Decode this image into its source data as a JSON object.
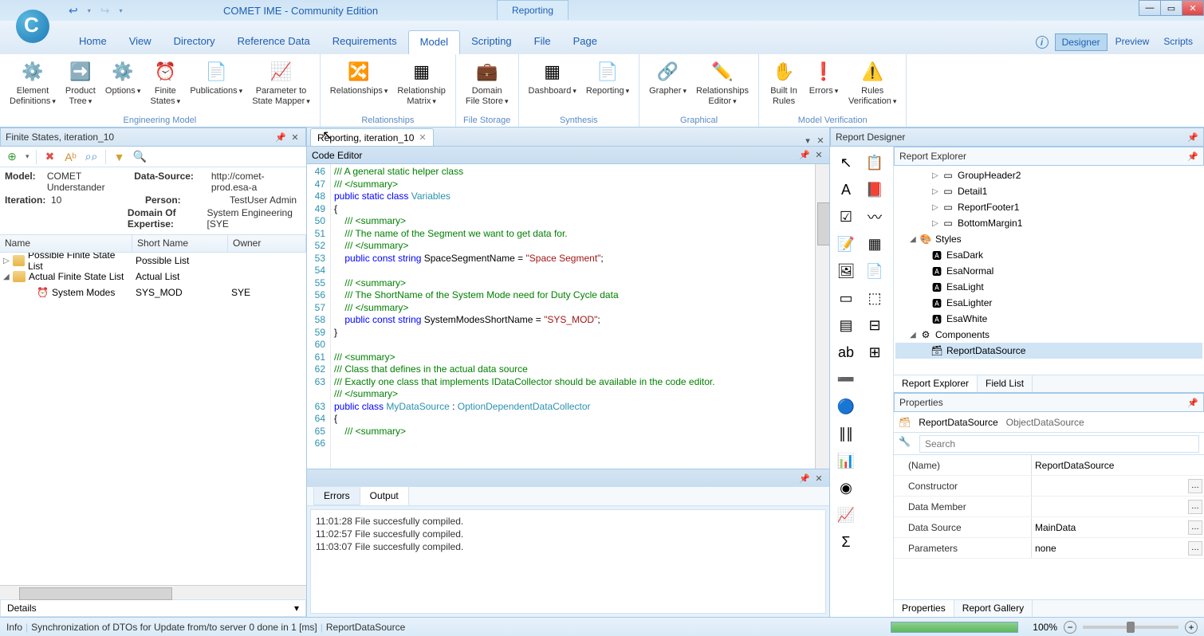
{
  "titlebar": {
    "app_title": "COMET IME - Community Edition",
    "context_tab": "Reporting"
  },
  "menu": {
    "items": [
      "Home",
      "View",
      "Directory",
      "Reference Data",
      "Requirements",
      "Model",
      "Scripting",
      "File",
      "Page"
    ],
    "active": "Model",
    "right": [
      "Designer",
      "Preview",
      "Scripts"
    ],
    "right_active": "Designer"
  },
  "ribbon": {
    "groups": [
      {
        "label": "Engineering Model",
        "buttons": [
          {
            "label": "Element\nDefinitions",
            "icon": "⚙️",
            "dd": true
          },
          {
            "label": "Product\nTree",
            "icon": "➡️",
            "dd": true
          },
          {
            "label": "Options",
            "icon": "⚙️",
            "dd": true
          },
          {
            "label": "Finite\nStates",
            "icon": "⏰",
            "dd": true
          },
          {
            "label": "Publications",
            "icon": "📄",
            "dd": true
          },
          {
            "label": "Parameter to\nState Mapper",
            "icon": "📈",
            "dd": true
          }
        ]
      },
      {
        "label": "Relationships",
        "buttons": [
          {
            "label": "Relationships",
            "icon": "🔀",
            "dd": true
          },
          {
            "label": "Relationship\nMatrix",
            "icon": "▦",
            "dd": true
          }
        ]
      },
      {
        "label": "File Storage",
        "buttons": [
          {
            "label": "Domain\nFile Store",
            "icon": "💼",
            "dd": true
          }
        ]
      },
      {
        "label": "Synthesis",
        "buttons": [
          {
            "label": "Dashboard",
            "icon": "▦",
            "dd": true
          },
          {
            "label": "Reporting",
            "icon": "📄",
            "dd": true
          }
        ]
      },
      {
        "label": "Graphical",
        "buttons": [
          {
            "label": "Grapher",
            "icon": "🔗",
            "dd": true
          },
          {
            "label": "Relationships\nEditor",
            "icon": "✏️",
            "dd": true
          }
        ]
      },
      {
        "label": "Model Verification",
        "buttons": [
          {
            "label": "Built In\nRules",
            "icon": "✋",
            "dd": false
          },
          {
            "label": "Errors",
            "icon": "❗",
            "dd": true
          },
          {
            "label": "Rules\nVerification",
            "icon": "⚠️",
            "dd": true
          }
        ]
      }
    ]
  },
  "left": {
    "title": "Finite States, iteration_10",
    "info": {
      "model_label": "Model:",
      "model": "COMET Understander",
      "ds_label": "Data-Source:",
      "ds": "http://comet-prod.esa-a",
      "iter_label": "Iteration:",
      "iter": "10",
      "person_label": "Person:",
      "person": "TestUser Admin",
      "doe_label": "Domain Of Expertise:",
      "doe": "System Engineering [SYE"
    },
    "cols": {
      "name": "Name",
      "short": "Short Name",
      "owner": "Owner"
    },
    "rows": [
      {
        "indent": 0,
        "exp": "▷",
        "icon": "folder",
        "name": "Possible Finite State List",
        "short": "Possible List",
        "owner": ""
      },
      {
        "indent": 0,
        "exp": "◢",
        "icon": "folder",
        "name": "Actual Finite State List",
        "short": "Actual List",
        "owner": ""
      },
      {
        "indent": 1,
        "exp": "",
        "icon": "clock",
        "name": "System Modes",
        "short": "SYS_MOD",
        "owner": "SYE"
      }
    ],
    "details": "Details"
  },
  "center": {
    "tab": "Reporting, iteration_10",
    "code_title": "Code Editor",
    "code": {
      "start": 46,
      "lines": [
        {
          "t": "/// A general static helper class",
          "c": "comment"
        },
        {
          "t": "/// </summary>",
          "c": "comment"
        },
        {
          "raw": "<span class='c-keyword'>public</span> <span class='c-keyword'>static</span> <span class='c-keyword'>class</span> <span class='c-class'>Variables</span>"
        },
        {
          "t": "{",
          "c": ""
        },
        {
          "t": "    /// <summary>",
          "c": "comment"
        },
        {
          "t": "    /// The name of the Segment we want to get data for.",
          "c": "comment"
        },
        {
          "t": "    /// </summary>",
          "c": "comment"
        },
        {
          "raw": "    <span class='c-keyword'>public</span> <span class='c-keyword'>const</span> <span class='c-keyword'>string</span> SpaceSegmentName = <span class='c-string'>\"Space Segment\"</span>;"
        },
        {
          "t": "",
          "c": ""
        },
        {
          "t": "    /// <summary>",
          "c": "comment"
        },
        {
          "t": "    /// The ShortName of the System Mode need for Duty Cycle data",
          "c": "comment"
        },
        {
          "t": "    /// </summary>",
          "c": "comment"
        },
        {
          "raw": "    <span class='c-keyword'>public</span> <span class='c-keyword'>const</span> <span class='c-keyword'>string</span> SystemModesShortName = <span class='c-string'>\"SYS_MOD\"</span>;"
        },
        {
          "t": "}",
          "c": ""
        },
        {
          "t": "",
          "c": ""
        },
        {
          "t": "/// <summary>",
          "c": "comment"
        },
        {
          "t": "/// Class that defines in the actual data source",
          "c": "comment"
        },
        {
          "t": "/// Exactly one class that implements IDataCollector should be available in the code editor.",
          "c": "comment",
          "wrap": true
        },
        {
          "t": "/// </summary>",
          "c": "comment"
        },
        {
          "raw": "<span class='c-keyword'>public</span> <span class='c-keyword'>class</span> <span class='c-class'>MyDataSource</span> : <span class='c-class'>OptionDependentDataCollector</span>"
        },
        {
          "t": "{",
          "c": ""
        },
        {
          "t": "    /// <summary>",
          "c": "comment"
        }
      ]
    },
    "output": {
      "tabs": [
        "Errors",
        "Output"
      ],
      "active": "Output",
      "lines": [
        "11:01:28 File succesfully compiled.",
        "11:02:57 File succesfully compiled.",
        "11:03:07 File succesfully compiled."
      ]
    }
  },
  "right": {
    "designer_title": "Report Designer",
    "explorer_title": "Report Explorer",
    "explorer": [
      {
        "indent": 3,
        "exp": "▷",
        "icon": "▭",
        "label": "GroupHeader2"
      },
      {
        "indent": 3,
        "exp": "▷",
        "icon": "▭",
        "label": "Detail1"
      },
      {
        "indent": 3,
        "exp": "▷",
        "icon": "▭",
        "label": "ReportFooter1"
      },
      {
        "indent": 3,
        "exp": "▷",
        "icon": "▭",
        "label": "BottomMargin1"
      },
      {
        "indent": 1,
        "exp": "◢",
        "icon": "🎨",
        "label": "Styles"
      },
      {
        "indent": 2,
        "exp": "",
        "icon": "🅰",
        "label": "EsaDark"
      },
      {
        "indent": 2,
        "exp": "",
        "icon": "🅰",
        "label": "EsaNormal"
      },
      {
        "indent": 2,
        "exp": "",
        "icon": "🅰",
        "label": "EsaLight"
      },
      {
        "indent": 2,
        "exp": "",
        "icon": "🅰",
        "label": "EsaLighter"
      },
      {
        "indent": 2,
        "exp": "",
        "icon": "🅰",
        "label": "EsaWhite"
      },
      {
        "indent": 1,
        "exp": "◢",
        "icon": "⚙",
        "label": "Components"
      },
      {
        "indent": 2,
        "exp": "",
        "icon": "🗃",
        "label": "ReportDataSource",
        "selected": true
      }
    ],
    "explorer_tabs": [
      "Report Explorer",
      "Field List"
    ],
    "props_title": "Properties",
    "props_selector": {
      "name": "ReportDataSource",
      "type": "ObjectDataSource"
    },
    "search_placeholder": "Search",
    "props": [
      {
        "name": "(Name)",
        "value": "ReportDataSource"
      },
      {
        "name": "Constructor",
        "value": "",
        "ellipsis": true
      },
      {
        "name": "Data Member",
        "value": "",
        "ellipsis": true
      },
      {
        "name": "Data Source",
        "value": "MainData",
        "ellipsis": true
      },
      {
        "name": "Parameters",
        "value": "none",
        "ellipsis": true
      }
    ],
    "props_tabs": [
      "Properties",
      "Report Gallery"
    ]
  },
  "status": {
    "info": "Info",
    "msg": "Synchronization of DTOs for Update from/to server 0 done in 1 [ms]",
    "ctx": "ReportDataSource",
    "zoom": "100%"
  }
}
